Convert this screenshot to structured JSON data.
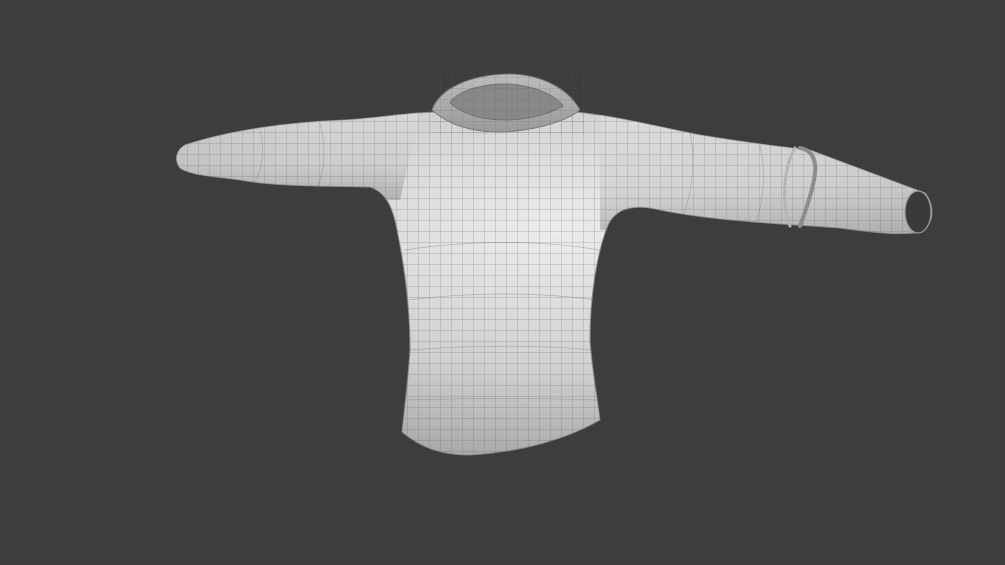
{
  "viewport": {
    "background_color": "#3d3d3d",
    "view_mode": "3d-viewport-solid-wireframe"
  },
  "model": {
    "object_type": "hoodie-sweater-mesh",
    "surface_color": "#d2d2d2",
    "wire_color": "#4a4a4a"
  }
}
